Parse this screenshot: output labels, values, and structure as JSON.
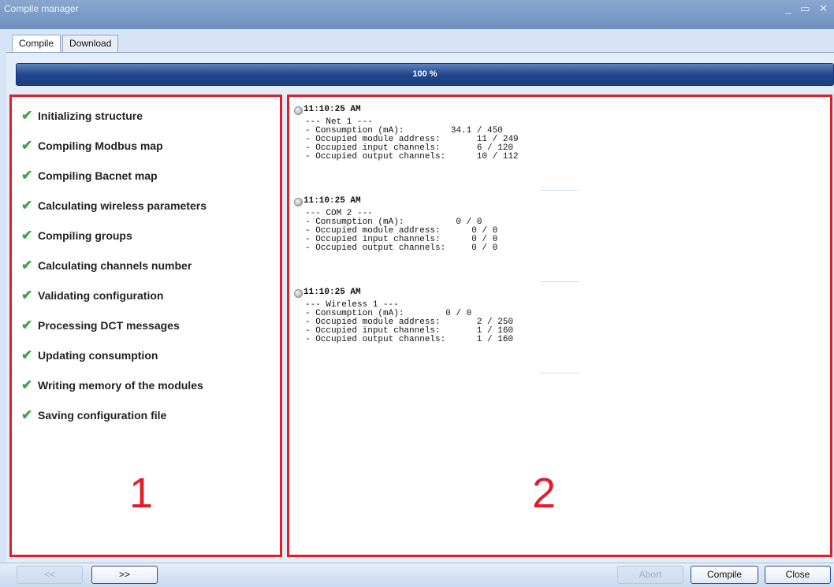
{
  "window": {
    "title": "Compile manager",
    "controls": "_ ▭ ✕"
  },
  "tabs": [
    {
      "label": "Compile"
    },
    {
      "label": "Download"
    }
  ],
  "progress": {
    "label": "100 %",
    "value": 1.0
  },
  "steps": [
    {
      "label": "Initializing structure"
    },
    {
      "label": "Compiling Modbus map"
    },
    {
      "label": "Compiling Bacnet map"
    },
    {
      "label": "Calculating wireless parameters"
    },
    {
      "label": "Compiling groups"
    },
    {
      "label": "Calculating channels number"
    },
    {
      "label": "Validating configuration"
    },
    {
      "label": "Processing DCT messages"
    },
    {
      "label": "Updating consumption"
    },
    {
      "label": "Writing memory of the modules"
    },
    {
      "label": "Saving configuration file"
    }
  ],
  "annotations": {
    "left": "1",
    "right": "2"
  },
  "log": [
    {
      "time": "11:10:25 AM",
      "header": "--- Net 1 ---",
      "lines": [
        "- Consumption (mA):         34.1 / 450",
        "- Occupied module address:       11 / 249",
        "- Occupied input channels:       6 / 120",
        "- Occupied output channels:      10 / 112"
      ]
    },
    {
      "time": "11:10:25 AM",
      "header": "--- COM 2 ---",
      "lines": [
        "- Consumption (mA):          0 / 0",
        "- Occupied module address:      0 / 0",
        "- Occupied input channels:      0 / 0",
        "- Occupied output channels:     0 / 0"
      ]
    },
    {
      "time": "11:10:25 AM",
      "header": "--- Wireless 1 ---",
      "lines": [
        "- Consumption (mA):        0 / 0",
        "- Occupied module address:       2 / 250",
        "- Occupied input channels:       1 / 160",
        "- Occupied output channels:      1 / 160"
      ]
    }
  ],
  "buttons": {
    "prev": "<<",
    "next": ">>",
    "abort": "Abort",
    "compile": "Compile",
    "close": "Close"
  },
  "colors": {
    "annotation": "#e31c2a",
    "check": "#3fa245",
    "progress": "#23478c"
  }
}
